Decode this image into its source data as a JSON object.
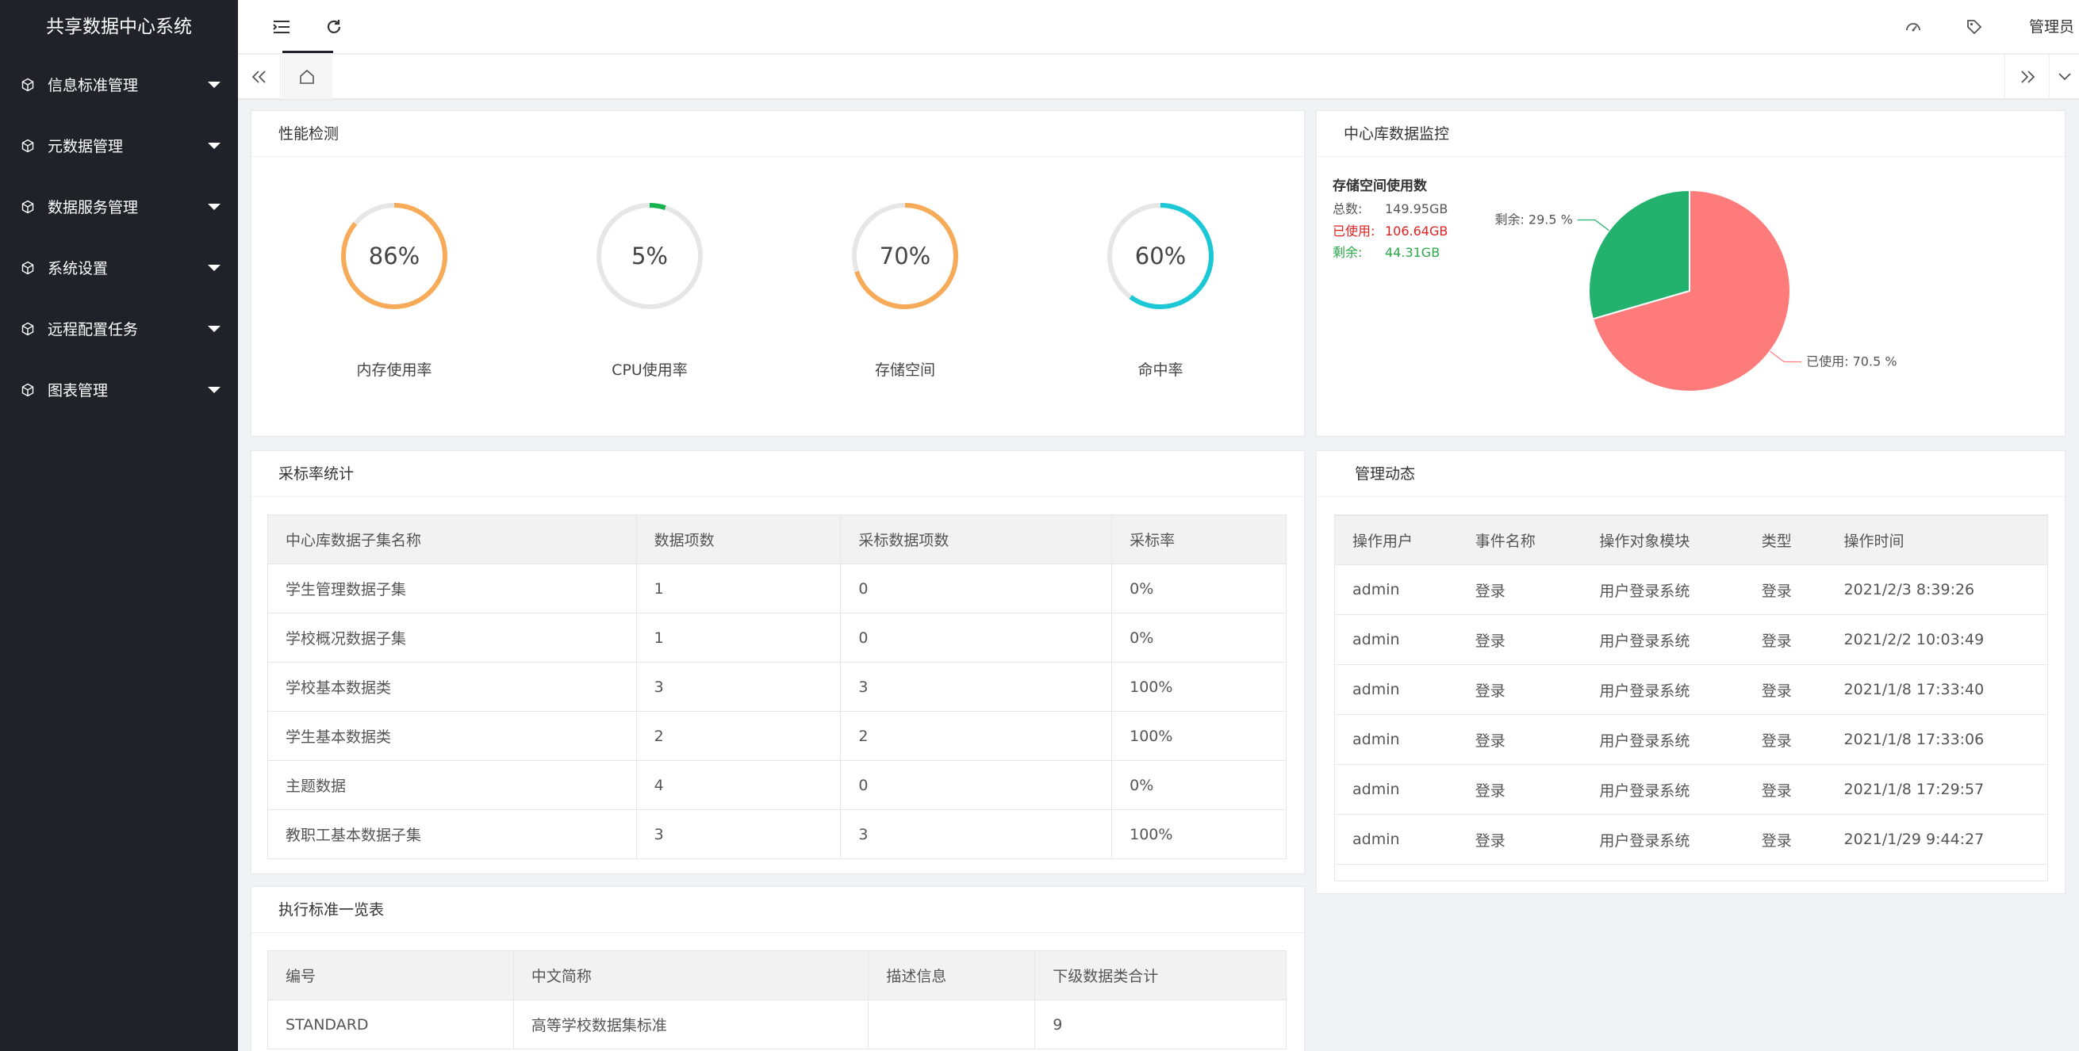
{
  "app": {
    "title": "共享数据中心系统"
  },
  "sidebar": {
    "items": [
      {
        "label": "信息标准管理",
        "icon": "cube-icon"
      },
      {
        "label": "元数据管理",
        "icon": "cube-icon"
      },
      {
        "label": "数据服务管理",
        "icon": "cube-icon"
      },
      {
        "label": "系统设置",
        "icon": "cube-icon"
      },
      {
        "label": "远程配置任务",
        "icon": "cube-icon"
      },
      {
        "label": "图表管理",
        "icon": "cube-icon"
      }
    ]
  },
  "topbar": {
    "user": "管理员"
  },
  "performance": {
    "title": "性能检测",
    "gauges": [
      {
        "label": "内存使用率",
        "value": 86,
        "display": "86%",
        "color": "#f7ab58"
      },
      {
        "label": "CPU使用率",
        "value": 5,
        "display": "5%",
        "color": "#17b351"
      },
      {
        "label": "存储空间",
        "value": 70,
        "display": "70%",
        "color": "#f7ab58"
      },
      {
        "label": "命中率",
        "value": 60,
        "display": "60%",
        "color": "#1dc8d6"
      }
    ]
  },
  "monitor": {
    "title": "中心库数据监控",
    "storage_title": "存储空间使用数",
    "total_label": "总数:",
    "total_value": "149.95GB",
    "used_label": "已使用:",
    "used_value": "106.64GB",
    "free_label": "剩余:",
    "free_value": "44.31GB",
    "used_color": "#e02020",
    "free_color": "#2aa84a",
    "pie_label_free": "剩余: 29.5 %",
    "pie_label_used": "已使用: 70.5 %"
  },
  "chart_data": {
    "type": "pie",
    "categories": [
      "已使用",
      "剩余"
    ],
    "values": [
      70.5,
      29.5
    ],
    "colors": [
      "#fd7b7b",
      "#23b26d"
    ],
    "legend": "none"
  },
  "rate": {
    "title": "采标率统计",
    "columns": [
      "中心库数据子集名称",
      "数据项数",
      "采标数据项数",
      "采标率"
    ],
    "rows": [
      [
        "学生管理数据子集",
        "1",
        "0",
        "0%"
      ],
      [
        "学校概况数据子集",
        "1",
        "0",
        "0%"
      ],
      [
        "学校基本数据类",
        "3",
        "3",
        "100%"
      ],
      [
        "学生基本数据类",
        "2",
        "2",
        "100%"
      ],
      [
        "主题数据",
        "4",
        "0",
        "0%"
      ],
      [
        "教职工基本数据子集",
        "3",
        "3",
        "100%"
      ]
    ]
  },
  "log": {
    "title": "管理动态",
    "columns": [
      "操作用户",
      "事件名称",
      "操作对象模块",
      "类型",
      "操作时间"
    ],
    "rows": [
      [
        "admin",
        "登录",
        "用户登录系统",
        "登录",
        "2021/2/3 8:39:26"
      ],
      [
        "admin",
        "登录",
        "用户登录系统",
        "登录",
        "2021/2/2 10:03:49"
      ],
      [
        "admin",
        "登录",
        "用户登录系统",
        "登录",
        "2021/1/8 17:33:40"
      ],
      [
        "admin",
        "登录",
        "用户登录系统",
        "登录",
        "2021/1/8 17:33:06"
      ],
      [
        "admin",
        "登录",
        "用户登录系统",
        "登录",
        "2021/1/8 17:29:57"
      ],
      [
        "admin",
        "登录",
        "用户登录系统",
        "登录",
        "2021/1/29 9:44:27"
      ]
    ]
  },
  "standards": {
    "title": "执行标准一览表",
    "columns": [
      "编号",
      "中文简称",
      "描述信息",
      "下级数据类合计"
    ],
    "rows": [
      [
        "STANDARD",
        "高等学校数据集标准",
        "",
        "9"
      ]
    ]
  }
}
